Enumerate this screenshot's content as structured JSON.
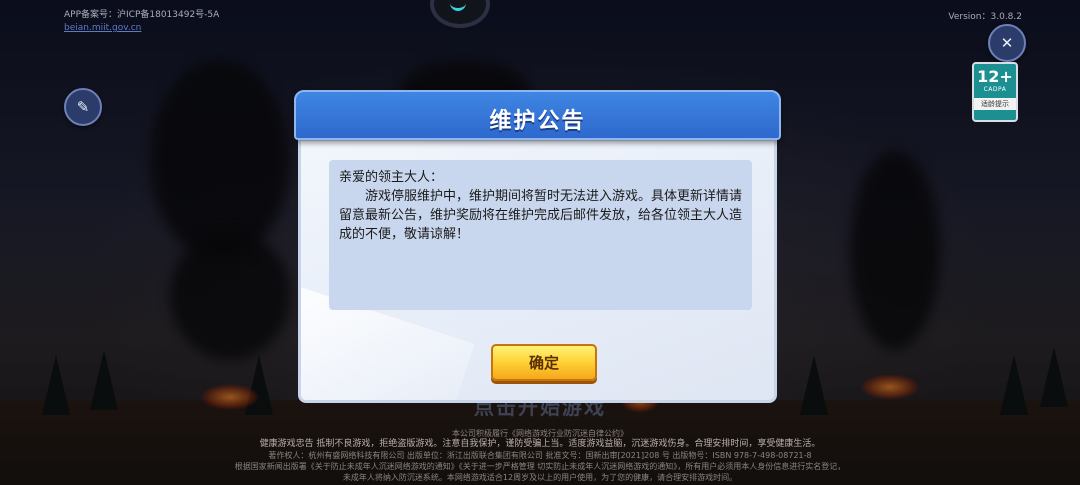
{
  "top_info": {
    "app_record": "APP备案号：沪ICP备18013492号-5A",
    "link_text": "beian.miit.gov.cn",
    "version": "Version：3.0.8.2"
  },
  "age_badge": {
    "rating": "12+",
    "org": "CADPA",
    "tip": "适龄提示"
  },
  "dialog": {
    "title": "维护公告",
    "greeting": "亲爱的领主大人：",
    "message": "游戏停服维护中，维护期间将暂时无法进入游戏。具体更新详情请留意最新公告，维护奖励将在维护完成后邮件发放，给各位领主大人造成的不便，敬请谅解！",
    "confirm_label": "确定"
  },
  "background_text": {
    "start_hint": "点击开始游戏"
  },
  "footer": {
    "line1": "本公司积极履行《网络游戏行业防沉迷自律公约》",
    "line2": "健康游戏忠告 抵制不良游戏，拒绝盗版游戏。注意自我保护，谨防受骗上当。适度游戏益脑，沉迷游戏伤身。合理安排时间，享受健康生活。",
    "line3": "著作权人：杭州有盛网络科技有限公司 出版单位：浙江出版联合集团有限公司 批准文号：国新出审[2021]208 号 出版物号：ISBN 978-7-498-08721-8",
    "line4": "根据国家新闻出版署《关于防止未成年人沉迷网络游戏的通知》《关于进一步严格管理 切实防止未成年人沉迷网络游戏的通知》，所有用户必须用本人身份信息进行实名登记，",
    "line5": "未成年人将纳入防沉迷系统。本网络游戏适合12周岁及以上的用户使用，为了您的健康，请合理安排游戏时间。"
  }
}
